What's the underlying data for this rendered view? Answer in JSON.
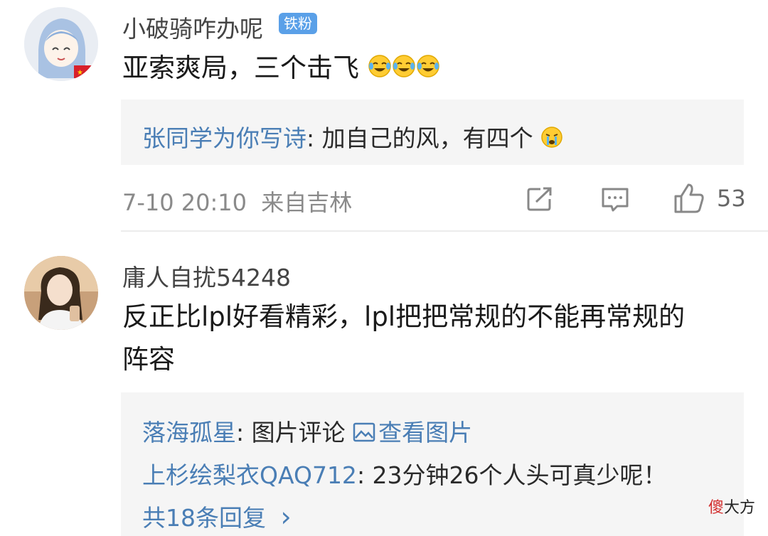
{
  "comments": [
    {
      "username": "小破骑咋办呢",
      "badge": "铁粉",
      "text": "亚索爽局，三个击飞",
      "emojis": [
        "laugh-cry-emoji",
        "laugh-cry-emoji",
        "laugh-cry-emoji"
      ],
      "replies": [
        {
          "user": "张同学为你写诗",
          "sep": ": ",
          "text": "加自己的风，有四个",
          "emoji": "crying-emoji"
        }
      ],
      "meta": {
        "date": "7-10 20:10",
        "location": "来自吉林"
      },
      "like_count": "53"
    },
    {
      "username": "庸人自扰54248",
      "text_line1": "反正比lpl好看精彩，lpl把把常规的不能再常规的",
      "text_line2": "阵容",
      "replies": [
        {
          "user": "落海孤星",
          "sep": ": ",
          "text": "图片评论 ",
          "link": "查看图片"
        },
        {
          "user": "上杉绘梨衣QAQ712",
          "sep": ": ",
          "text": "23分钟26个人头可真少呢！"
        }
      ],
      "more_replies": "共18条回复",
      "more_arrow": "›"
    }
  ],
  "watermark": {
    "part1": "傻",
    "part2": "大方"
  },
  "colors": {
    "link": "#4a7eb5",
    "badge": "#5aa0e8",
    "reply_bg": "#f5f5f5"
  }
}
